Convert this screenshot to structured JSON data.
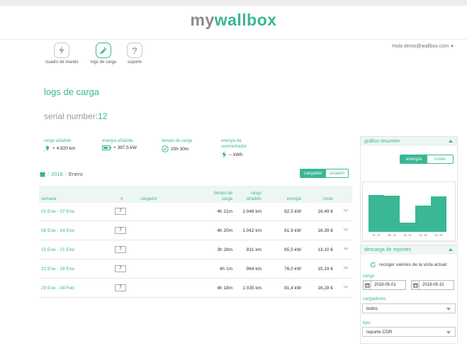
{
  "header": {
    "brand_my": "my",
    "brand_wallbox": "wallbox",
    "user": "Hola demo@wallbox.com"
  },
  "nav": [
    {
      "label": "cuadro de mando"
    },
    {
      "label": "logs de carga"
    },
    {
      "label": "soporte"
    }
  ],
  "page": {
    "title": "logs de carga",
    "serial_label": "serial number:",
    "serial_value": "12"
  },
  "stats": {
    "range": {
      "title": "rango añadido",
      "value": "+ 4.920 km"
    },
    "energy": {
      "title": "energía añadida",
      "value": "+ 387,5 kW"
    },
    "time": {
      "title": "tiempo de carga",
      "value": "20h 30m"
    },
    "supplier": {
      "title_line1": "energía de",
      "title_line2": "suministrador",
      "value": "-- kWh"
    }
  },
  "breadcrumb": {
    "year": "2018",
    "sep": "/",
    "month": "Enero"
  },
  "table_toggle": {
    "cargador": "cargador",
    "usuario": "usuario",
    "active": "cargador"
  },
  "table": {
    "headers": {
      "semana": "semana",
      "num": "#",
      "cargador": "cargador",
      "tiempo_l1": "tiempo de",
      "tiempo_l2": "carga",
      "rango_l1": "rango",
      "rango_l2": "añadido",
      "energia": "energía",
      "coste": "coste"
    },
    "rows": [
      {
        "semana": "01 Ene - 07 Ene",
        "num": "7",
        "tiempo": "4h 21m",
        "rango": "1.048 km",
        "energia": "82,5 kW",
        "coste": "16,49 €"
      },
      {
        "semana": "08 Ene - 14 Ene",
        "num": "7",
        "tiempo": "4h 20m",
        "rango": "1.042 km",
        "energia": "81,9 kW",
        "coste": "16,39 €"
      },
      {
        "semana": "15 Ene - 21 Ene",
        "num": "7",
        "tiempo": "3h 28m",
        "rango": "831 km",
        "energia": "65,5 kW",
        "coste": "13,10 €"
      },
      {
        "semana": "22 Ene - 28 Ene",
        "num": "7",
        "tiempo": "4h 1m",
        "rango": "964 km",
        "energia": "76,0 kW",
        "coste": "15,19 €"
      },
      {
        "semana": "29 Ene - 04 Feb",
        "num": "7",
        "tiempo": "4h 18m",
        "rango": "1.035 km",
        "energia": "81,4 kW",
        "coste": "16,28 €"
      }
    ]
  },
  "summary_panel": {
    "title": "gráfico resumen",
    "toggle_energia": "energía",
    "toggle_coste": "coste",
    "active": "energía"
  },
  "chart_data": {
    "type": "bar",
    "categories": [
      "01 - 07",
      "08 - 14",
      "15 - 21",
      "22 - 28",
      "29 - 04"
    ],
    "values": [
      82.5,
      81.9,
      65.5,
      76.0,
      81.4
    ],
    "ylim": [
      60,
      85
    ],
    "grid": false,
    "legend": "none",
    "color": "#3ab795"
  },
  "reports_panel": {
    "title": "descarga de reportes",
    "refresh_label": "recoger valores de la vista actual",
    "range_label": "rango",
    "date_from": "2018-05-01",
    "date_to": "2018-05-31",
    "chargers_label": "cargadores",
    "chargers_value": "todos",
    "type_label": "tipo",
    "type_value": "reporte CDR"
  },
  "colors": {
    "accent": "#3ab795",
    "muted": "#9a9a9a"
  }
}
